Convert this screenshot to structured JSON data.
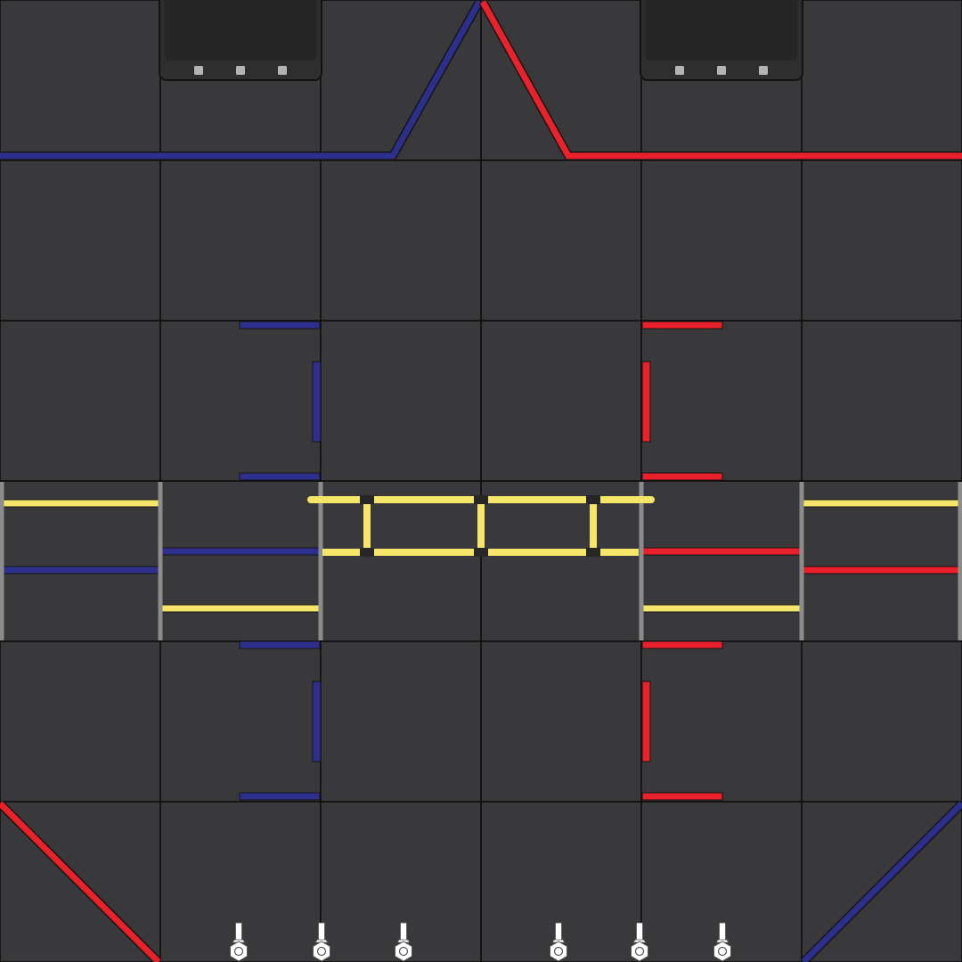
{
  "field": {
    "name": "game-field",
    "tile_rows": 6,
    "tile_cols": 6,
    "colors": {
      "tile": "#39393b",
      "grid": "#0d0d0d",
      "blue": "#2d2f8c",
      "red": "#e8212a",
      "yellow": "#f5e66a",
      "rail": "#8c8c8c",
      "bracket": "#2a2a2a",
      "backdrop": "#2e2e2e",
      "backdrop_light": "#b4b4b4",
      "truss_joint": "#262626",
      "pixel_white": "#ffffff"
    }
  },
  "elements": {
    "backdrops": [
      "blue-backdrop",
      "red-backdrop"
    ],
    "pixel_stacks": 6,
    "spike_marks": [
      "blue-upper",
      "blue-lower",
      "red-upper",
      "red-lower"
    ],
    "stage_doors": [
      "left-outer",
      "left-inner",
      "right-inner",
      "right-outer"
    ],
    "truss": "center-stage-truss"
  }
}
